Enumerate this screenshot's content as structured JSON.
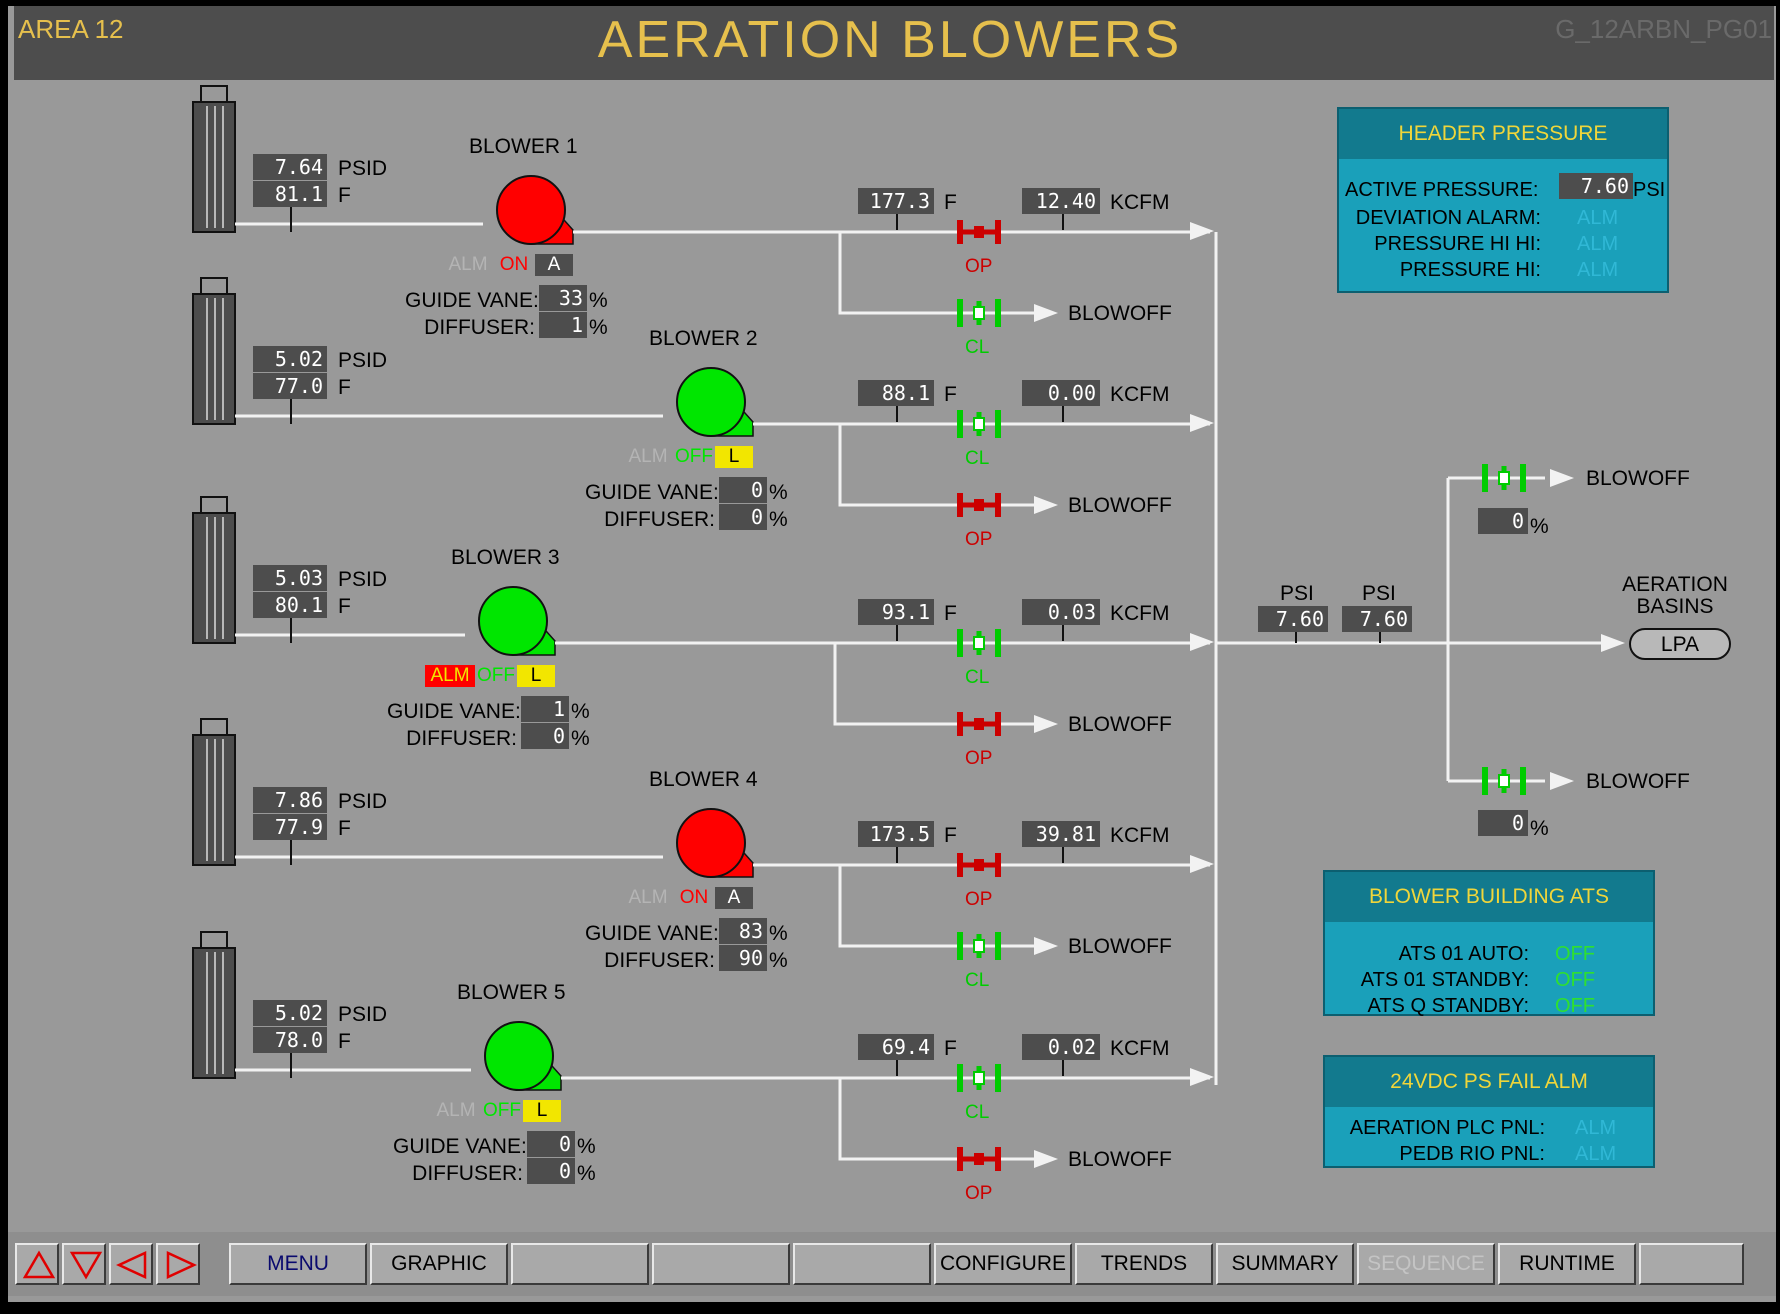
{
  "header": {
    "area": "AREA 12",
    "title": "AERATION BLOWERS",
    "page_id": "G_12ARBN_PG01"
  },
  "colors": {
    "background": "#999999",
    "header_bar": "#4d4d4d",
    "title": "#e6c04d",
    "running_red": "#ff0000",
    "stopped_green": "#00e600",
    "valve_open": "#cc0000",
    "valve_closed": "#00cc00",
    "panel": "#1aa0ba",
    "mode_local": "#f2e600"
  },
  "units": {
    "psid": "PSID",
    "f": "F",
    "kcfm": "KCFM",
    "pct": "%",
    "psi": "PSI"
  },
  "blowers": [
    {
      "name": "BLOWER 1",
      "psid": "7.64",
      "temp": "81.1",
      "state_color": "red",
      "alm": "ALM",
      "alm_active": false,
      "run": "ON",
      "mode": "A",
      "guide_vane_label": "GUIDE VANE:",
      "diffuser_label": "DIFFUSER:",
      "guide_vane": "33",
      "diffuser": "1",
      "disch_temp": "177.3",
      "flow": "12.40",
      "disch_valve": "OP",
      "blowoff_valve": "CL",
      "blowoff_label": "BLOWOFF"
    },
    {
      "name": "BLOWER 2",
      "psid": "5.02",
      "temp": "77.0",
      "state_color": "green",
      "alm": "ALM",
      "alm_active": false,
      "run": "OFF",
      "mode": "L",
      "guide_vane_label": "GUIDE VANE:",
      "diffuser_label": "DIFFUSER:",
      "guide_vane": "0",
      "diffuser": "0",
      "disch_temp": "88.1",
      "flow": "0.00",
      "disch_valve": "CL",
      "blowoff_valve": "OP",
      "blowoff_label": "BLOWOFF"
    },
    {
      "name": "BLOWER 3",
      "psid": "5.03",
      "temp": "80.1",
      "state_color": "green",
      "alm": "ALM",
      "alm_active": true,
      "run": "OFF",
      "mode": "L",
      "guide_vane_label": "GUIDE VANE:",
      "diffuser_label": "DIFFUSER:",
      "guide_vane": "1",
      "diffuser": "0",
      "disch_temp": "93.1",
      "flow": "0.03",
      "disch_valve": "CL",
      "blowoff_valve": "OP",
      "blowoff_label": "BLOWOFF"
    },
    {
      "name": "BLOWER 4",
      "psid": "7.86",
      "temp": "77.9",
      "state_color": "red",
      "alm": "ALM",
      "alm_active": false,
      "run": "ON",
      "mode": "A",
      "guide_vane_label": "GUIDE VANE:",
      "diffuser_label": "DIFFUSER:",
      "guide_vane": "83",
      "diffuser": "90",
      "disch_temp": "173.5",
      "flow": "39.81",
      "disch_valve": "OP",
      "blowoff_valve": "CL",
      "blowoff_label": "BLOWOFF"
    },
    {
      "name": "BLOWER 5",
      "psid": "5.02",
      "temp": "78.0",
      "state_color": "green",
      "alm": "ALM",
      "alm_active": false,
      "run": "OFF",
      "mode": "L",
      "guide_vane_label": "GUIDE VANE:",
      "diffuser_label": "DIFFUSER:",
      "guide_vane": "0",
      "diffuser": "0",
      "disch_temp": "69.4",
      "flow": "0.02",
      "disch_valve": "CL",
      "blowoff_valve": "OP",
      "blowoff_label": "BLOWOFF"
    }
  ],
  "header_line": {
    "psi_label_1": "PSI",
    "psi_value_1": "7.60",
    "psi_label_2": "PSI",
    "psi_value_2": "7.60",
    "blowoff_top": {
      "label": "BLOWOFF",
      "value": "0"
    },
    "blowoff_bottom": {
      "label": "BLOWOFF",
      "value": "0"
    },
    "destination_label": "AERATION BASINS",
    "destination_button": "LPA"
  },
  "header_pressure_panel": {
    "title": "HEADER PRESSURE",
    "active_label": "ACTIVE PRESSURE:",
    "active_value": "7.60",
    "active_unit": "PSI",
    "rows": [
      {
        "label": "DEVIATION ALARM:",
        "status": "ALM"
      },
      {
        "label": "PRESSURE HI HI:",
        "status": "ALM"
      },
      {
        "label": "PRESSURE HI:",
        "status": "ALM"
      }
    ]
  },
  "ats_panel": {
    "title": "BLOWER BUILDING ATS",
    "rows": [
      {
        "label": "ATS 01 AUTO:",
        "status": "OFF"
      },
      {
        "label": "ATS 01 STANDBY:",
        "status": "OFF"
      },
      {
        "label": "ATS Q STANDBY:",
        "status": "OFF"
      }
    ]
  },
  "ps_panel": {
    "title": "24VDC PS FAIL ALM",
    "rows": [
      {
        "label": "AERATION PLC PNL:",
        "status": "ALM"
      },
      {
        "label": "PEDB RIO PNL:",
        "status": "ALM"
      }
    ]
  },
  "nav": {
    "arrows": [
      "arrow-up-icon",
      "arrow-down-icon",
      "arrow-left-icon",
      "arrow-right-icon"
    ],
    "buttons": [
      {
        "label": "MENU",
        "enabled": true
      },
      {
        "label": "GRAPHIC",
        "enabled": true
      },
      {
        "label": "",
        "enabled": true
      },
      {
        "label": "",
        "enabled": true
      },
      {
        "label": "",
        "enabled": true
      },
      {
        "label": "CONFIGURE",
        "enabled": true
      },
      {
        "label": "TRENDS",
        "enabled": true
      },
      {
        "label": "SUMMARY",
        "enabled": true
      },
      {
        "label": "SEQUENCE",
        "enabled": false
      },
      {
        "label": "RUNTIME",
        "enabled": true
      },
      {
        "label": "",
        "enabled": true
      }
    ]
  }
}
